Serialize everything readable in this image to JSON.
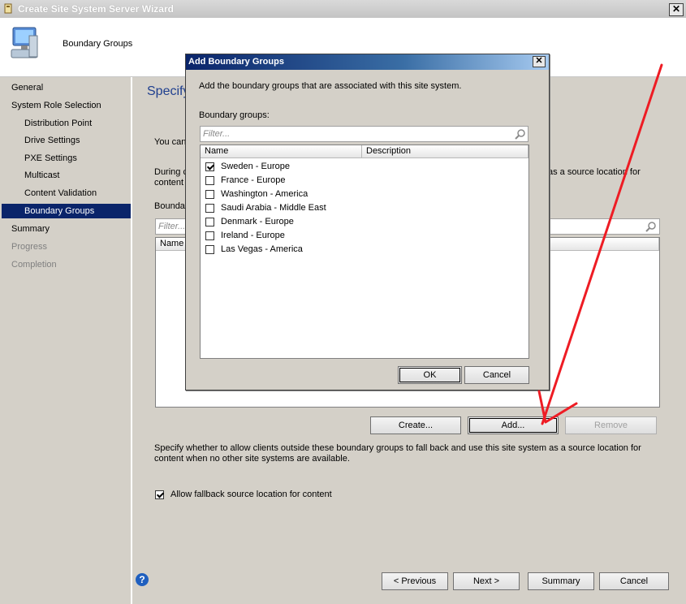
{
  "window": {
    "title": "Create Site System Server Wizard",
    "close_glyph": "✕"
  },
  "header": {
    "page_label": "Boundary Groups"
  },
  "nav": {
    "items": [
      {
        "label": "General",
        "state": "normal"
      },
      {
        "label": "System Role Selection",
        "state": "normal"
      },
      {
        "label": "Distribution Point",
        "state": "sub"
      },
      {
        "label": "Drive Settings",
        "state": "sub"
      },
      {
        "label": "PXE Settings",
        "state": "sub"
      },
      {
        "label": "Multicast",
        "state": "sub"
      },
      {
        "label": "Content Validation",
        "state": "sub"
      },
      {
        "label": "Boundary Groups",
        "state": "selected"
      },
      {
        "label": "Summary",
        "state": "normal"
      },
      {
        "label": "Progress",
        "state": "disabled"
      },
      {
        "label": "Completion",
        "state": "disabled"
      }
    ]
  },
  "main": {
    "title_partial": "Specify",
    "line1_partial": "You can",
    "line2_partial_a": "During c",
    "line2_partial_b": "content",
    "line2_right": "as a source location for",
    "list_label_partial": "Bounda",
    "filter_placeholder": "Filter...",
    "col_name_partial": "Name",
    "create_label": "Create...",
    "add_label": "Add...",
    "remove_label": "Remove",
    "fallback_text": "Specify whether to allow clients outside these boundary groups to fall back and use this site system as a source location for content when no other site systems are available.",
    "allow_fallback_label": "Allow fallback source location for content",
    "allow_fallback_checked": true
  },
  "footer": {
    "help_glyph": "?",
    "previous_label": "< Previous",
    "next_label": "Next >",
    "summary_label": "Summary",
    "cancel_label": "Cancel"
  },
  "dialog": {
    "title": "Add Boundary Groups",
    "close_glyph": "✕",
    "description": "Add the boundary groups that are associated with this site system.",
    "list_label": "Boundary groups:",
    "filter_placeholder": "Filter...",
    "columns": [
      "Name",
      "Description"
    ],
    "rows": [
      {
        "name": "Sweden - Europe",
        "checked": true
      },
      {
        "name": "France - Europe",
        "checked": false
      },
      {
        "name": "Washington - America",
        "checked": false
      },
      {
        "name": "Saudi Arabia - Middle East",
        "checked": false
      },
      {
        "name": "Denmark - Europe",
        "checked": false
      },
      {
        "name": "Ireland - Europe",
        "checked": false
      },
      {
        "name": "Las Vegas - America",
        "checked": false
      }
    ],
    "ok_label": "OK",
    "cancel_label": "Cancel"
  },
  "annotation": {
    "arrow_color": "#ee1c24"
  }
}
